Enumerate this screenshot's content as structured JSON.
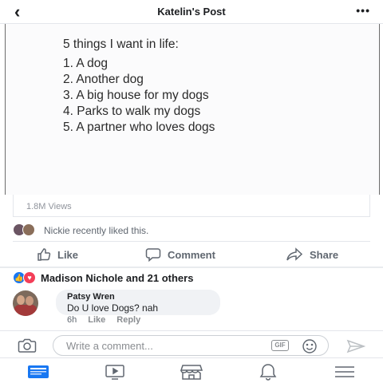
{
  "header": {
    "back_icon": "chevron-left-icon",
    "title": "Katelin's Post",
    "more_icon": "more-dots-icon"
  },
  "post": {
    "heading": "5 things I want in life:",
    "items": [
      "1. A dog",
      "2. Another dog",
      "3. A big house for my dogs",
      "4. Parks to walk my dogs",
      "5. A partner who loves dogs"
    ],
    "views": "1.8M Views"
  },
  "liked": {
    "text": "Nickie recently liked this."
  },
  "actions": {
    "like_label": "Like",
    "comment_label": "Comment",
    "share_label": "Share"
  },
  "reactions": {
    "summary": "Madison Nichole and 21 others"
  },
  "comment": {
    "author": "Patsy Wren",
    "text": "Do U love Dogs?  nah",
    "time": "6h",
    "like_label": "Like",
    "reply_label": "Reply"
  },
  "composer": {
    "placeholder": "Write a comment...",
    "gif_label": "GIF"
  },
  "colors": {
    "accent": "#1877f2",
    "love": "#f33e58",
    "muted": "#606770"
  }
}
